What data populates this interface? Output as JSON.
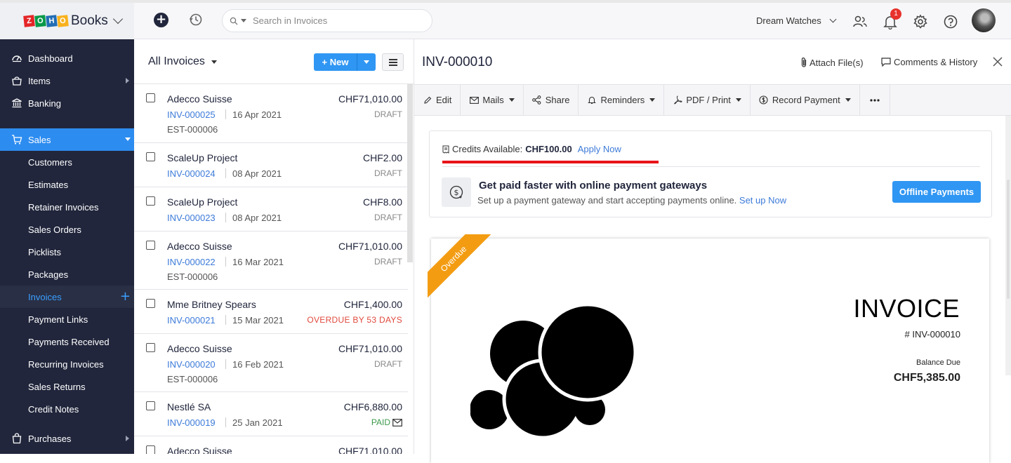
{
  "app": {
    "logo_letters": [
      "Z",
      "O",
      "H",
      "O"
    ],
    "logo_colors": [
      "#e42527",
      "#089949",
      "#226db4",
      "#f9b21d"
    ],
    "name": "Books"
  },
  "topbar": {
    "search_placeholder": "Search in Invoices",
    "org_name": "Dream Watches",
    "notification_count": "1"
  },
  "sidebar": {
    "items": [
      {
        "label": "Dashboard",
        "icon": "dashboard-icon"
      },
      {
        "label": "Items",
        "icon": "items-icon"
      },
      {
        "label": "Banking",
        "icon": "bank-icon"
      },
      {
        "label": "Sales",
        "icon": "cart-icon"
      },
      {
        "label": "Purchases",
        "icon": "bag-icon"
      }
    ],
    "sales_sub": [
      "Customers",
      "Estimates",
      "Retainer Invoices",
      "Sales Orders",
      "Picklists",
      "Packages",
      "Invoices",
      "Payment Links",
      "Payments Received",
      "Recurring Invoices",
      "Sales Returns",
      "Credit Notes"
    ]
  },
  "list": {
    "title": "All Invoices",
    "new_label": "New",
    "rows": [
      {
        "customer": "Adecco Suisse",
        "amount": "CHF71,010.00",
        "number": "INV-000025",
        "date": "16 Apr 2021",
        "status": "DRAFT",
        "ref": "EST-000006"
      },
      {
        "customer": "ScaleUp Project",
        "amount": "CHF2.00",
        "number": "INV-000024",
        "date": "08 Apr 2021",
        "status": "DRAFT",
        "ref": ""
      },
      {
        "customer": "ScaleUp Project",
        "amount": "CHF8.00",
        "number": "INV-000023",
        "date": "08 Apr 2021",
        "status": "DRAFT",
        "ref": ""
      },
      {
        "customer": "Adecco Suisse",
        "amount": "CHF71,010.00",
        "number": "INV-000022",
        "date": "16 Mar 2021",
        "status": "DRAFT",
        "ref": "EST-000006"
      },
      {
        "customer": "Mme Britney Spears",
        "amount": "CHF1,400.00",
        "number": "INV-000021",
        "date": "15 Mar 2021",
        "status": "OVERDUE BY 53 DAYS",
        "ref": ""
      },
      {
        "customer": "Adecco Suisse",
        "amount": "CHF71,010.00",
        "number": "INV-000020",
        "date": "16 Feb 2021",
        "status": "DRAFT",
        "ref": "EST-000006"
      },
      {
        "customer": "Nestlé SA",
        "amount": "CHF6,880.00",
        "number": "INV-000019",
        "date": "25 Jan 2021",
        "status": "PAID",
        "ref": ""
      },
      {
        "customer": "Adecco Suisse",
        "amount": "CHF71,010.00",
        "number": "",
        "date": "",
        "status": "",
        "ref": ""
      }
    ]
  },
  "detail": {
    "title": "INV-000010",
    "attach_label": "Attach File(s)",
    "comments_label": "Comments & History",
    "toolbar": {
      "edit": "Edit",
      "mails": "Mails",
      "share": "Share",
      "reminders": "Reminders",
      "pdf_print": "PDF / Print",
      "record_payment": "Record Payment"
    },
    "credits": {
      "label": "Credits Available:",
      "amount": "CHF100.00",
      "apply": "Apply Now"
    },
    "gateway": {
      "title": "Get paid faster with online payment gateways",
      "desc": "Set up a payment gateway and start accepting payments online.",
      "setup": "Set up Now",
      "offline_btn": "Offline Payments"
    },
    "invoice": {
      "ribbon": "Overdue",
      "heading": "INVOICE",
      "number": "# INV-000010",
      "balance_label": "Balance Due",
      "balance_value": "CHF5,385.00"
    }
  },
  "colors": {
    "sidebar_bg": "#21263c",
    "accent": "#2f96f3",
    "ribbon": "#f39c12",
    "overdue": "#e0493d",
    "paid": "#3d9a4b",
    "highlight_underline": "#e8141a"
  }
}
